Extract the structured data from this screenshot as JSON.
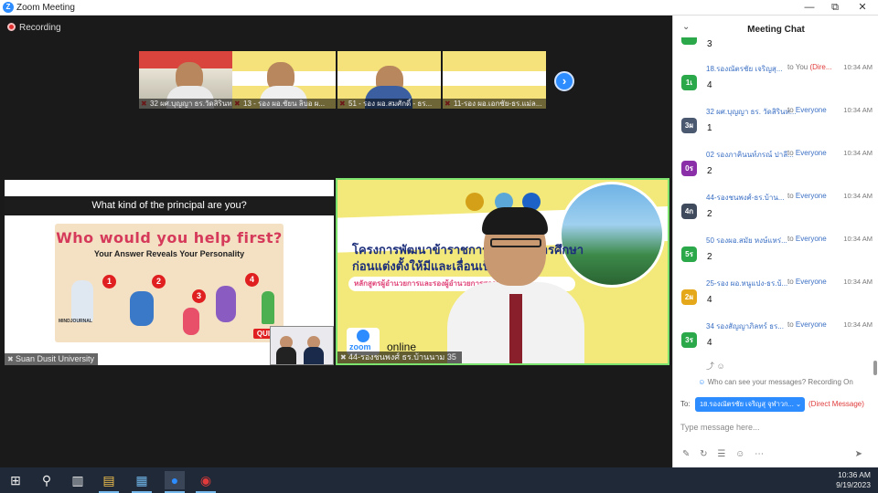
{
  "window": {
    "title": "Zoom Meeting",
    "minimize": "—",
    "restore": "⧉",
    "close": "✕"
  },
  "recording": {
    "label": "Recording"
  },
  "thumbnails": [
    {
      "label": "32 ผศ.บุญญา ธร.วัดสิรินท..."
    },
    {
      "label": "13 - รอง ผอ.ชัยน ลิบอ ผ..."
    },
    {
      "label": "51 - รอง ผอ.สมศักดิ์ - ธร..."
    },
    {
      "label": "11-รอง ผอ.เอกชัย-ธร.แม่ล..."
    }
  ],
  "next_button": "›",
  "share_left": {
    "question": "What kind of the principal are you?",
    "headline": "Who would you help first?",
    "subheadline": "Your Answer Reveals Your Personality",
    "numbers": [
      "1",
      "2",
      "3",
      "4"
    ],
    "quiz": "QUIZ",
    "brand": "MINDJOURNAL",
    "name": "Suan Dusit University"
  },
  "share_right": {
    "title_line1": "โครงการพัฒนาข้าราชการครูและ...การศึกษา",
    "title_line2": "ก่อนแต่งตั้งให้มีและเลื่อนเป็นวิทย...",
    "subtitle": "หลักสูตรผู้อำนวยการและรองผู้อำนวยการสถาน...ที่ 133",
    "zoom_word": "zoom",
    "online": "online",
    "name": "44-รองชนพงศ์ ธร.บ้านนาม 35"
  },
  "chat": {
    "title": "Meeting Chat",
    "collapse": "⌄",
    "top_partial": "3",
    "messages": [
      {
        "avatar": "1เ",
        "color": "#2aa84a",
        "from": "18.รองณัตรชัย เจริญสุ...",
        "to": "to You",
        "dm": "(Dire...",
        "time": "10:34 AM",
        "text": "4"
      },
      {
        "avatar": "3ผ",
        "color": "#4a5870",
        "from": "32 ผศ.บุญญา ธร. วัดสิรินท...",
        "to": "to",
        "who": "Everyone",
        "time": "10:34 AM",
        "text": "1"
      },
      {
        "avatar": "0ร",
        "color": "#8b2fa8",
        "from": "02 รองภาคินนท์ภรณ์ ปาลี...",
        "to": "to",
        "who": "Everyone",
        "time": "10:34 AM",
        "text": "2"
      },
      {
        "avatar": "4ก",
        "color": "#3f4a5c",
        "from": "44-รองชนพงศ์-ธร.บ้าน...",
        "to": "to",
        "who": "Everyone",
        "time": "10:34 AM",
        "text": "2"
      },
      {
        "avatar": "5ร",
        "color": "#2aa84a",
        "from": "50 รองผอ.สมัย หงษ์แหร่...",
        "to": "to",
        "who": "Everyone",
        "time": "10:34 AM",
        "text": "2"
      },
      {
        "avatar": "2ผ",
        "color": "#e6a81b",
        "from": "25-รอง ผอ.หนูแปง-ธร.บ้...",
        "to": "to",
        "who": "Everyone",
        "time": "10:34 AM",
        "text": "4"
      },
      {
        "avatar": "3ร",
        "color": "#2aa84a",
        "from": "34 รองสัญญาภิลทร์ ธร...",
        "to": "to",
        "who": "Everyone",
        "time": "10:34 AM",
        "text": "4"
      }
    ],
    "reactions": "⤴ ☺",
    "who_can_see": "Who can see your messages? Recording On",
    "to_label": "To:",
    "recipient": "18.รองณัตรชัย เจริญสุ จุฬาวก... ⌄",
    "direct_message": "(Direct Message)",
    "input_placeholder": "Type message here...",
    "tools": [
      "✎",
      "↻",
      "☰",
      "☺",
      "⋯"
    ],
    "send": "➤"
  },
  "taskbar": {
    "icons": [
      {
        "name": "windows-start-icon",
        "glyph": "⊞"
      },
      {
        "name": "search-icon",
        "glyph": "⚲"
      },
      {
        "name": "task-view-icon",
        "glyph": "▥"
      },
      {
        "name": "file-explorer-icon",
        "glyph": "▤"
      },
      {
        "name": "store-icon",
        "glyph": "▦"
      },
      {
        "name": "zoom-app-icon",
        "glyph": "●"
      },
      {
        "name": "app-red-icon",
        "glyph": "◉"
      }
    ],
    "time": "10:36 AM",
    "date": "9/19/2023"
  }
}
